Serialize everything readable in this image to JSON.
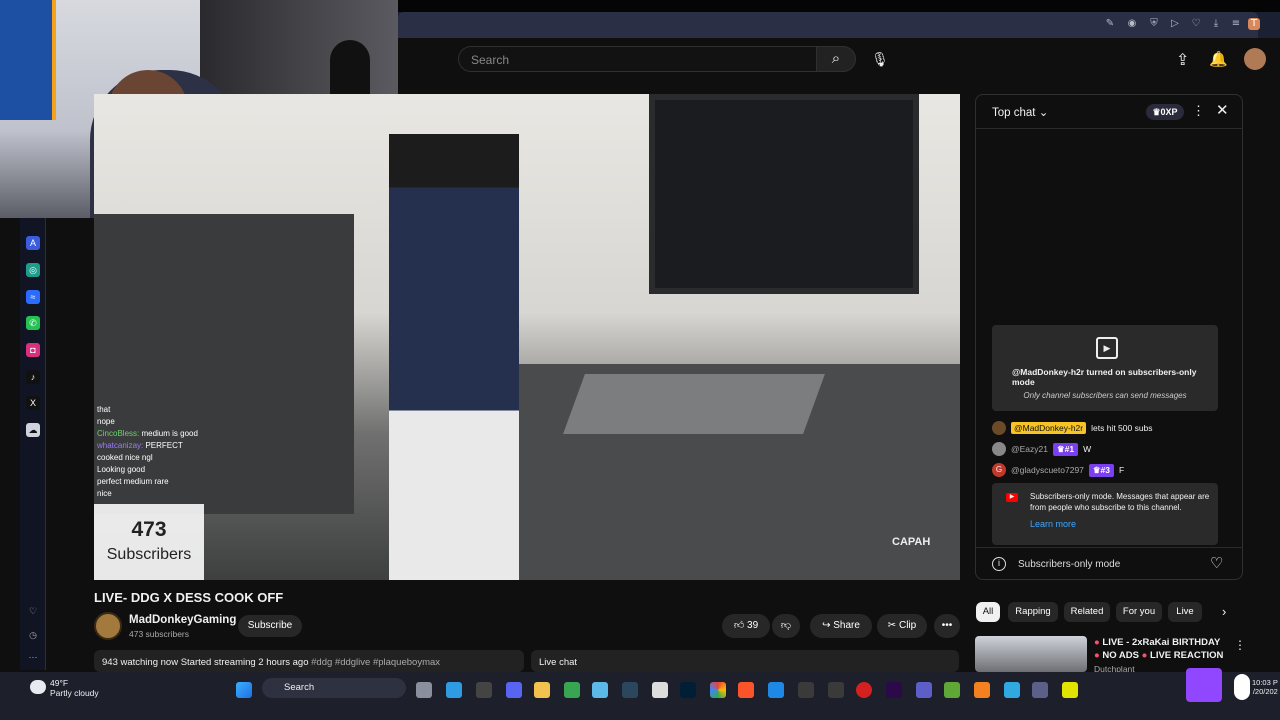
{
  "header": {
    "search_placeholder": "Search"
  },
  "video": {
    "title": "LIVE- DDG X DESS COOK OFF",
    "overlay_chat": [
      {
        "name": "",
        "text": "that"
      },
      {
        "name": "",
        "text": "nope"
      },
      {
        "name": "CincoBless",
        "text": "medium is good"
      },
      {
        "name": "whatcanizay",
        "text": "PERFECT"
      },
      {
        "name": "",
        "text": "cooked nice ngl"
      },
      {
        "name": "",
        "text": "Looking good"
      },
      {
        "name": "",
        "text": "perfect medium rare"
      },
      {
        "name": "",
        "text": "nice"
      }
    ],
    "subs_widget": {
      "count": "473",
      "label": "Subscribers"
    },
    "watermark": "CAPAH"
  },
  "channel": {
    "name": "MadDonkeyGaming",
    "subscribers": "473 subscribers",
    "subscribe_label": "Subscribe"
  },
  "actions": {
    "likes": "39",
    "share": "Share",
    "clip": "Clip",
    "more": "•••"
  },
  "description": {
    "stats": "943 watching now  Started streaming 2 hours ago",
    "tags": "#ddg #ddglive #plaqueboymax"
  },
  "livechat_label": "Live chat",
  "chat": {
    "mode": "Top chat",
    "xp": "0XP",
    "notice_title": "@MadDonkey-h2r turned on subscribers-only mode",
    "notice_sub": "Only channel subscribers can send messages",
    "messages": [
      {
        "author": "@MadDonkey-h2r",
        "badge": "",
        "text": "lets hit 500 subs"
      },
      {
        "author": "@Eazy21",
        "badge": "#1",
        "text": "W"
      },
      {
        "author": "@gladyscueto7297",
        "badge": "#3",
        "text": "F"
      }
    ],
    "notice2_text": "Subscribers-only mode. Messages that appear are from people who subscribe to this channel.",
    "learn_more": "Learn more",
    "footer": "Subscribers-only mode"
  },
  "chips": [
    "All",
    "Rapping",
    "Related",
    "For you",
    "Live"
  ],
  "recommendation": {
    "title_line1": "LIVE - 2xRaKai BIRTHDAY",
    "title_line2": "NO ADS",
    "title_line3": "LIVE REACTION",
    "channel": "Dutchplant"
  },
  "taskbar": {
    "temp": "49°F",
    "weather": "Partly cloudy",
    "search": "Search",
    "time": "10:03 P",
    "date": "/20/202"
  }
}
